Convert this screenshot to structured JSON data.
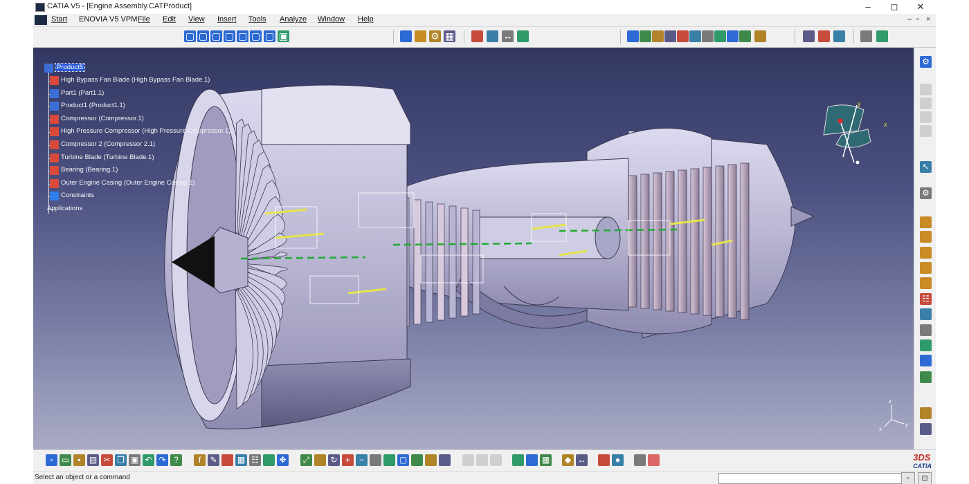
{
  "window": {
    "title": "CATIA V5 - [Engine Assembly.CATProduct]",
    "controls": {
      "minimize": "–",
      "maximize": "◻",
      "close": "✕"
    },
    "mdi_controls": {
      "minimize": "–",
      "restore": "▫",
      "close": "×"
    }
  },
  "menubar": {
    "items": [
      "Start",
      "ENOVIA V5 VPM",
      "File",
      "Edit",
      "View",
      "Insert",
      "Tools",
      "Analyze",
      "Window",
      "Help"
    ]
  },
  "tree": {
    "root": "Product5",
    "items": [
      "High Bypass Fan Blade (High Bypass Fan Blade.1)",
      "Part1 (Part1.1)",
      "Product1 (Product1.1)",
      "Compressor (Compressor.1)",
      "High Pressure Compressor (High Pressure Compressor.1)",
      "Compressor 2 (Compressor 2.1)",
      "Turbine Blade (Turbine Blade.1)",
      "Bearing (Bearing.1)",
      "Outer Engine Casing (Outer Engine Casing.1)",
      "Constraints",
      "Applications"
    ]
  },
  "compass": {
    "x_label": "x",
    "y_label": "y"
  },
  "axis_triad": {
    "x_label": "x",
    "y_label": "y",
    "z_label": "z"
  },
  "bottom": {
    "logo": "CATIA",
    "logo_mark": "3DS"
  },
  "statusbar": {
    "message": "Select an object or a command",
    "input_placeholder": ""
  },
  "icons": {
    "top": [
      "cube-icon",
      "cube-icon",
      "cube-icon",
      "cube-icon",
      "cube-icon",
      "cube-icon",
      "cube-icon",
      "view-icon",
      "assembly-icon",
      "product-icon",
      "gear-icon",
      "table-icon",
      "constraint-icon",
      "snap-icon",
      "measure-icon",
      "component-icon",
      "sketch-icon",
      "material-icon",
      "analysis-icon",
      "section-icon",
      "clash-icon",
      "edit-icon",
      "catalog-icon",
      "paint-icon",
      "compass-icon",
      "move-icon",
      "fast-multi-icon",
      "explode-icon",
      "manipulate-icon",
      "update-icon",
      "publish-icon",
      "reconcile-icon"
    ],
    "right": [
      "gear-icon",
      "disabled-icon",
      "disabled-icon",
      "disabled-icon",
      "disabled-icon",
      "cursor-icon",
      "cog-icon",
      "product-icon",
      "product-icon",
      "product-icon",
      "replace-icon",
      "replace-icon",
      "graph-icon",
      "reorder-icon",
      "bom-icon",
      "catalog-icon",
      "tools-icon",
      "fix-icon",
      "flexible-icon",
      "snap-icon"
    ],
    "bottom": [
      "new-icon",
      "open-icon",
      "save-icon",
      "print-icon",
      "cut-icon",
      "copy-icon",
      "paste-icon",
      "undo-icon",
      "redo-icon",
      "help-icon",
      "formula-icon",
      "comment-icon",
      "light-icon",
      "table-icon",
      "graph-icon",
      "hide-icon",
      "pan-icon",
      "fit-all-icon",
      "fly-icon",
      "rotate-icon",
      "zoom-in-icon",
      "zoom-out-icon",
      "normal-view-icon",
      "views-icon",
      "cube-icon",
      "render-icon",
      "hide-show-icon",
      "swap-icon",
      "disabled-icon",
      "disabled-icon",
      "disabled-icon",
      "camera-icon",
      "stack-icon",
      "table-icon",
      "lamp-icon",
      "measure-icon",
      "material-icon",
      "sphere-icon",
      "analysis-icon",
      "grid-icon"
    ]
  },
  "colors": {
    "viewport_top": "#333862",
    "viewport_bottom": "#a9abc6",
    "tree_selection": "#2a5bd8",
    "engine_body": "#c8c6de",
    "constraint_yellow": "#e7e44a",
    "constraint_green": "#22aa33"
  }
}
